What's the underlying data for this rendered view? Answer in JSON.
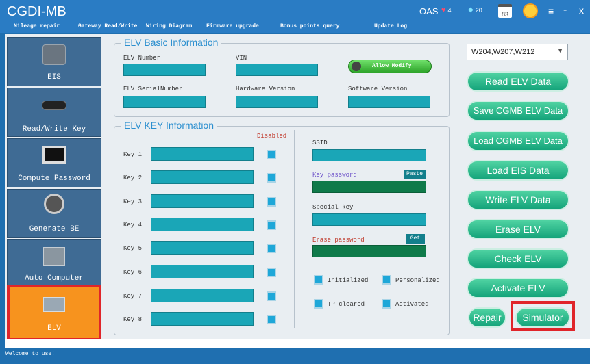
{
  "app": {
    "title": "CGDI-MB"
  },
  "topbar": {
    "oas_label": "OAS",
    "hearts": "4",
    "diamonds": "20",
    "calendar": "83",
    "close_label": "x",
    "min_label": "-"
  },
  "menu": [
    "Mileage repair",
    "Gateway Read/Write",
    "Wiring Diagram",
    "Firmware upgrade",
    "Bonus points query",
    "Update Log"
  ],
  "sidebar": [
    {
      "label": "EIS",
      "icon": "eis-module-icon"
    },
    {
      "label": "Read/Write Key",
      "icon": "car-key-icon"
    },
    {
      "label": "Compute Password",
      "icon": "monitor-icon"
    },
    {
      "label": "Generate BE",
      "icon": "key-fob-icon"
    },
    {
      "label": "Auto Computer",
      "icon": "ecu-icon"
    },
    {
      "label": "ELV",
      "icon": "elv-lock-icon"
    }
  ],
  "elv_basic": {
    "title": "ELV Basic Information",
    "elv_number": "ELV Number",
    "vin": "VIN",
    "allow_modify": "Allow Modify",
    "elv_serial": "ELV SerialNumber",
    "hardware_version": "Hardware Version",
    "software_version": "Software Version"
  },
  "elv_key": {
    "title": "ELV KEY Information",
    "disabled_label": "Disabled",
    "keys": [
      "Key 1",
      "Key 2",
      "Key 3",
      "Key 4",
      "Key 5",
      "Key 6",
      "Key 7",
      "Key 8"
    ],
    "ssid": "SSID",
    "key_password": "Key password",
    "paste": "Paste",
    "special_key": "Special key",
    "erase_password": "Erase password",
    "get": "Get",
    "initialized": "Initialized",
    "personalized": "Personalized",
    "tp_cleared": "TP cleared",
    "activated": "Activated"
  },
  "model_select": {
    "value": "W204,W207,W212"
  },
  "actions": [
    "Read ELV Data",
    "Save CGMB ELV Data",
    "Load CGMB ELV Data",
    "Load EIS Data",
    "Write ELV Data",
    "Erase ELV",
    "Check ELV",
    "Activate ELV"
  ],
  "bottom_buttons": {
    "repair": "Repair",
    "simulator": "Simulator"
  },
  "status": "Welcome to use!"
}
